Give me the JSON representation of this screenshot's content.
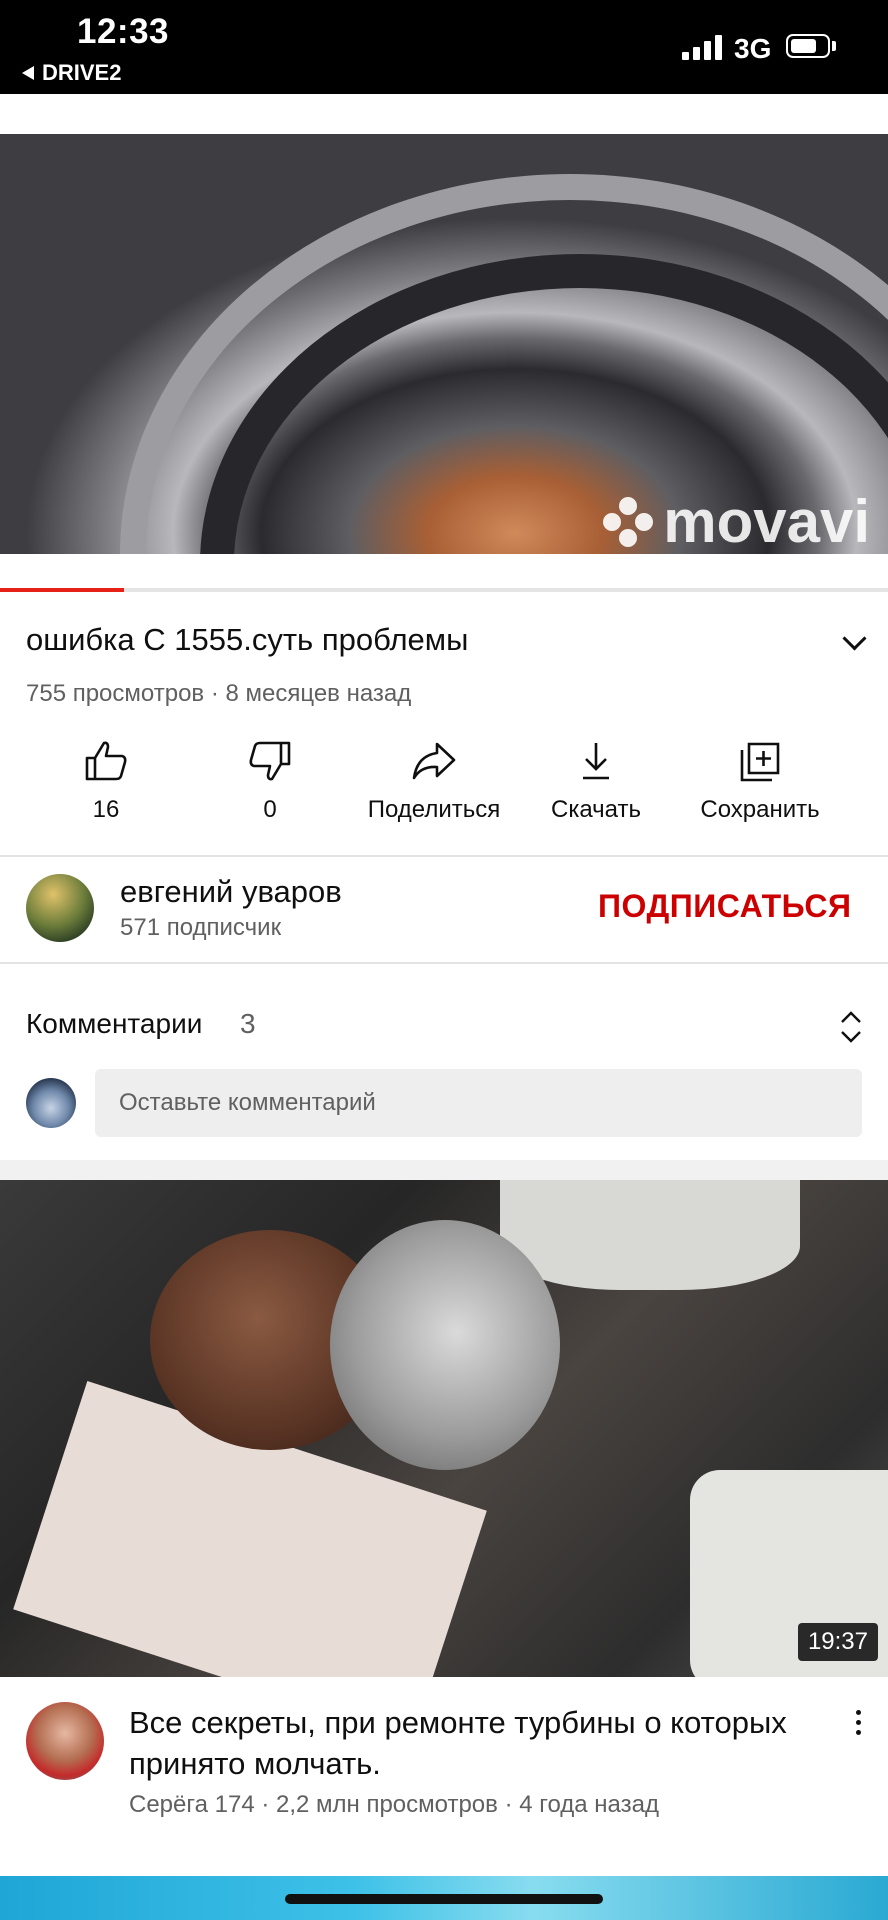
{
  "status_bar": {
    "time": "12:33",
    "back_app": "DRIVE2",
    "network": "3G",
    "battery_level": 0.7
  },
  "player": {
    "watermark": "movavi",
    "progress": 0.14,
    "progress_color": "#e62117"
  },
  "video": {
    "title": "ошибка С 1555.суть проблемы",
    "meta": "755 просмотров · 8 месяцев назад"
  },
  "actions": [
    {
      "icon": "thumbs-up-icon",
      "label": "16"
    },
    {
      "icon": "thumbs-down-icon",
      "label": "0"
    },
    {
      "icon": "share-icon",
      "label": "Поделиться"
    },
    {
      "icon": "download-icon",
      "label": "Скачать"
    },
    {
      "icon": "save-playlist-icon",
      "label": "Сохранить"
    }
  ],
  "channel": {
    "name": "евгений уваров",
    "subscribers": "571 подписчик",
    "subscribe_label": "ПОДПИСАТЬСЯ",
    "subscribe_color": "#cc0000"
  },
  "comments": {
    "title": "Комментарии",
    "count": "3",
    "placeholder": "Оставьте комментарий"
  },
  "recommended": [
    {
      "title": "Все секреты, при ремонте турбины о которых принято молчать.",
      "meta": "Серёга 174 · 2,2 млн просмотров · 4 года назад",
      "duration": "19:37"
    }
  ]
}
